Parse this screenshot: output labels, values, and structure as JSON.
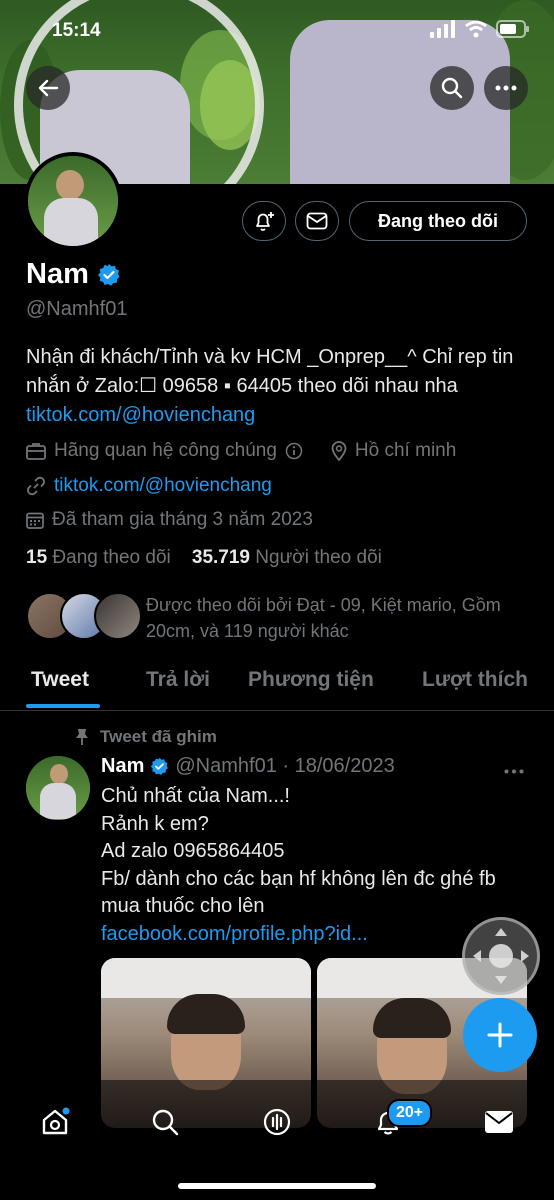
{
  "status_bar": {
    "time": "15:14"
  },
  "profile": {
    "name": "Nam",
    "handle": "@Namhf01",
    "following_button": "Đang theo dõi",
    "bio_line": "Nhận đi khách/Tỉnh và kv HCM _Onprep__^ Chỉ rep tin nhắn ở Zalo:☐ 09658 ▪ 64405 theo dõi nhau nha ",
    "bio_link": "tiktok.com/@hovienchang",
    "category": "Hãng quan hệ công chúng",
    "location": "Hồ chí minh",
    "website": "tiktok.com/@hovienchang",
    "joined": "Đã tham gia tháng 3 năm 2023",
    "following_count": "15",
    "following_label": "Đang theo dõi",
    "followers_count": "35.719",
    "followers_label": "Người theo dõi",
    "followed_by": "Được theo dõi bởi Đạt - 09, Kiệt mario, Gồm 20cm, và 119 người khác"
  },
  "tabs": [
    "Tweet",
    "Trả lời",
    "Phương tiện",
    "Lượt thích"
  ],
  "pinned_label": "Tweet đã ghim",
  "tweet": {
    "name": "Nam",
    "handle_date": "@Namhf01 · 18/06/2023",
    "lines": [
      "Chủ nhất của Nam...!",
      "Rảnh k em?",
      "Ad zalo 0965864405",
      "Fb/ dành cho các bạn hf không lên đc ghé fb mua thuốc cho lên"
    ],
    "link": "facebook.com/profile.php?id..."
  },
  "notifications_badge": "20+",
  "colors": {
    "accent": "#1d9bf0",
    "muted": "#71767b",
    "border": "#2f3336"
  }
}
